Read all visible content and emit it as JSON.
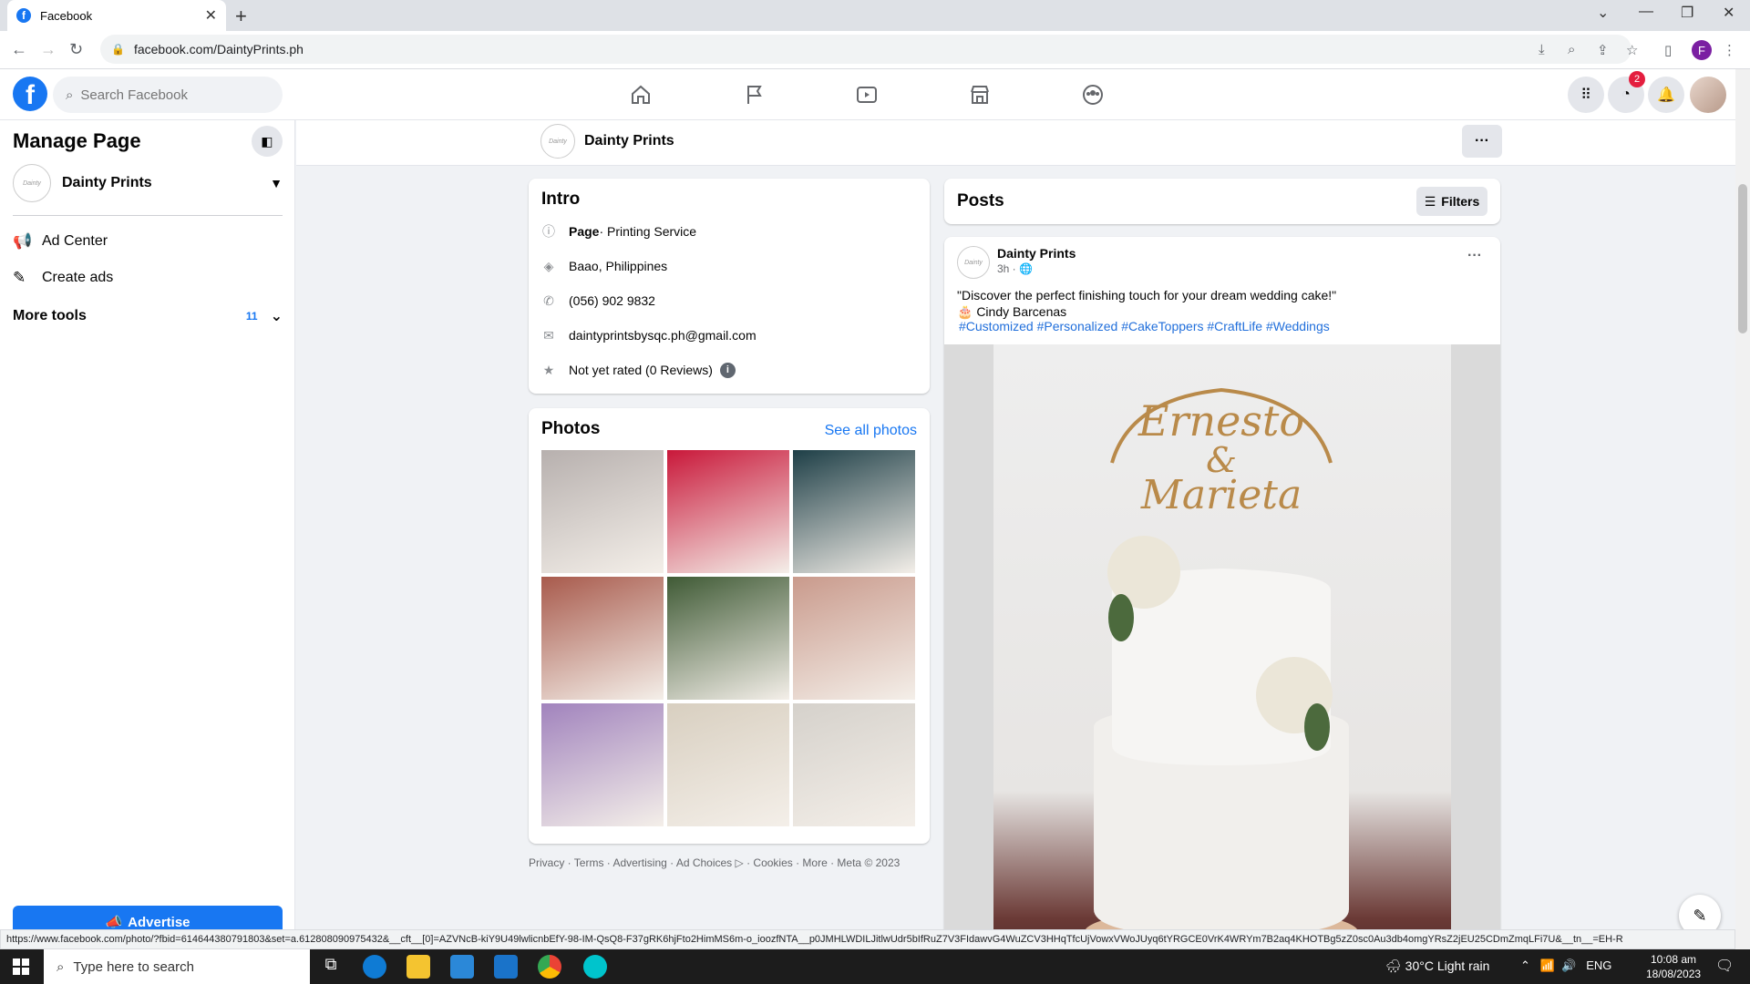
{
  "browser": {
    "tab_title": "Facebook",
    "url": "facebook.com/DaintyPrints.ph",
    "profile_initial": "F"
  },
  "fb": {
    "search_placeholder": "Search Facebook",
    "messenger_badge": "2"
  },
  "sidebar": {
    "title": "Manage Page",
    "page_name": "Dainty Prints",
    "items": [
      {
        "label": "Ad Center",
        "icon": "megaphone-icon"
      },
      {
        "label": "Create ads",
        "icon": "edit-icon"
      }
    ],
    "more_tools_label": "More tools",
    "more_tools_count": "11",
    "advertise_label": "Advertise"
  },
  "pagebar": {
    "name": "Dainty Prints"
  },
  "intro": {
    "title": "Intro",
    "category_bold": "Page",
    "category_rest": " · Printing Service",
    "location": "Baao, Philippines",
    "phone": "(056) 902 9832",
    "email": "daintyprintsbysqc.ph@gmail.com",
    "rating": "Not yet rated (0 Reviews)"
  },
  "photos": {
    "title": "Photos",
    "see_all": "See all photos",
    "colors": [
      "#b7b0ae",
      "#c9183a",
      "#1e3f47",
      "#a85a4c",
      "#3f5a35",
      "#c99a8c",
      "#a183bd",
      "#d8cfc0",
      "#d5d1cb"
    ]
  },
  "footer": "Privacy · Terms · Advertising · Ad Choices ▷ · Cookies · More · Meta © 2023",
  "posts": {
    "title": "Posts",
    "filters_label": "Filters",
    "author": "Dainty Prints",
    "time": "3h · ",
    "text_line1": "\"Discover the perfect finishing touch for your dream wedding cake!\"",
    "text_line2": "🎂 Cindy Barcenas",
    "hashtags": "#Customized #Personalized #CakeToppers #CraftLife #Weddings",
    "topper_line1": "Ernesto",
    "topper_line2": "&",
    "topper_line3": "Marieta"
  },
  "statusbar_url": "https://www.facebook.com/photo/?fbid=614644380791803&set=a.612808090975432&__cft__[0]=AZVNcB-kiY9U49lwlicnbEfY-98-IM-QsQ8-F37gRK6hjFto2HimMS6m-o_ioozfNTA__p0JMHLWDILJitlwUdr5bIfRuZ7V3FIdawvG4WuZCV3HHqTfcUjVowxVWoJUyq6tYRGCE0VrK4WRYm7B2aq4KHOTBg5zZ0sc0Au3db4omgYRsZ2jEU25CDmZmqLFi7U&__tn__=EH-R",
  "taskbar": {
    "search_placeholder": "Type here to search",
    "weather": "30°C  Light rain",
    "lang": "ENG",
    "time": "10:08 am",
    "date": "18/08/2023"
  }
}
